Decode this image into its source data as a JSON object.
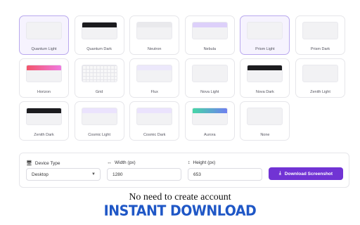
{
  "themes": [
    {
      "label": "Quantum Light",
      "bar": "",
      "selected": true
    },
    {
      "label": "Quantum Dark",
      "bar": "#1c1c1f",
      "selected": false
    },
    {
      "label": "Neutron",
      "bar": "#e9e9ec",
      "selected": false
    },
    {
      "label": "Nebula",
      "bar": "#ddd0fa",
      "selected": false
    },
    {
      "label": "Prism Light",
      "bar": "",
      "selected": true
    },
    {
      "label": "Prism Dark",
      "bar": "",
      "selected": false
    },
    {
      "label": "Horizon",
      "bar": "linear-gradient(90deg,#f2566b,#f07ae0)",
      "selected": false
    },
    {
      "label": "Grid",
      "bar": "",
      "pattern": "grid",
      "selected": false
    },
    {
      "label": "Flux",
      "bar": "#ece8fb",
      "selected": false
    },
    {
      "label": "Nova Light",
      "bar": "",
      "selected": false
    },
    {
      "label": "Nova Dark",
      "bar": "#1c1c1f",
      "selected": false
    },
    {
      "label": "Zenith Light",
      "bar": "",
      "selected": false
    },
    {
      "label": "Zenith Dark",
      "bar": "#1c1c1f",
      "selected": false
    },
    {
      "label": "Cosmic Light",
      "bar": "#ebe3fd",
      "selected": false
    },
    {
      "label": "Cosmic Dark",
      "bar": "#ebe3fd",
      "selected": false
    },
    {
      "label": "Aurora",
      "bar": "linear-gradient(90deg,#46d6a6,#6f7ff0)",
      "selected": false
    },
    {
      "label": "None",
      "bar": "",
      "selected": false
    }
  ],
  "settings": {
    "device_type_label": "Device Type",
    "device_type_value": "Desktop",
    "width_label": "Width (px)",
    "width_value": "1280",
    "height_label": "Height (px)",
    "height_value": "653",
    "download_label": "Download Screenshot"
  },
  "icons": {
    "device": "monitor-icon",
    "width": "horizontal-arrows-icon",
    "height": "vertical-arrows-icon",
    "download": "download-icon",
    "dropdown": "chevron-down-icon"
  },
  "colors": {
    "accent": "#7133d4",
    "caption_blue": "#1f57c6"
  },
  "caption": {
    "line1": "No need to create account",
    "line2": "INSTANT DOWNLOAD"
  }
}
